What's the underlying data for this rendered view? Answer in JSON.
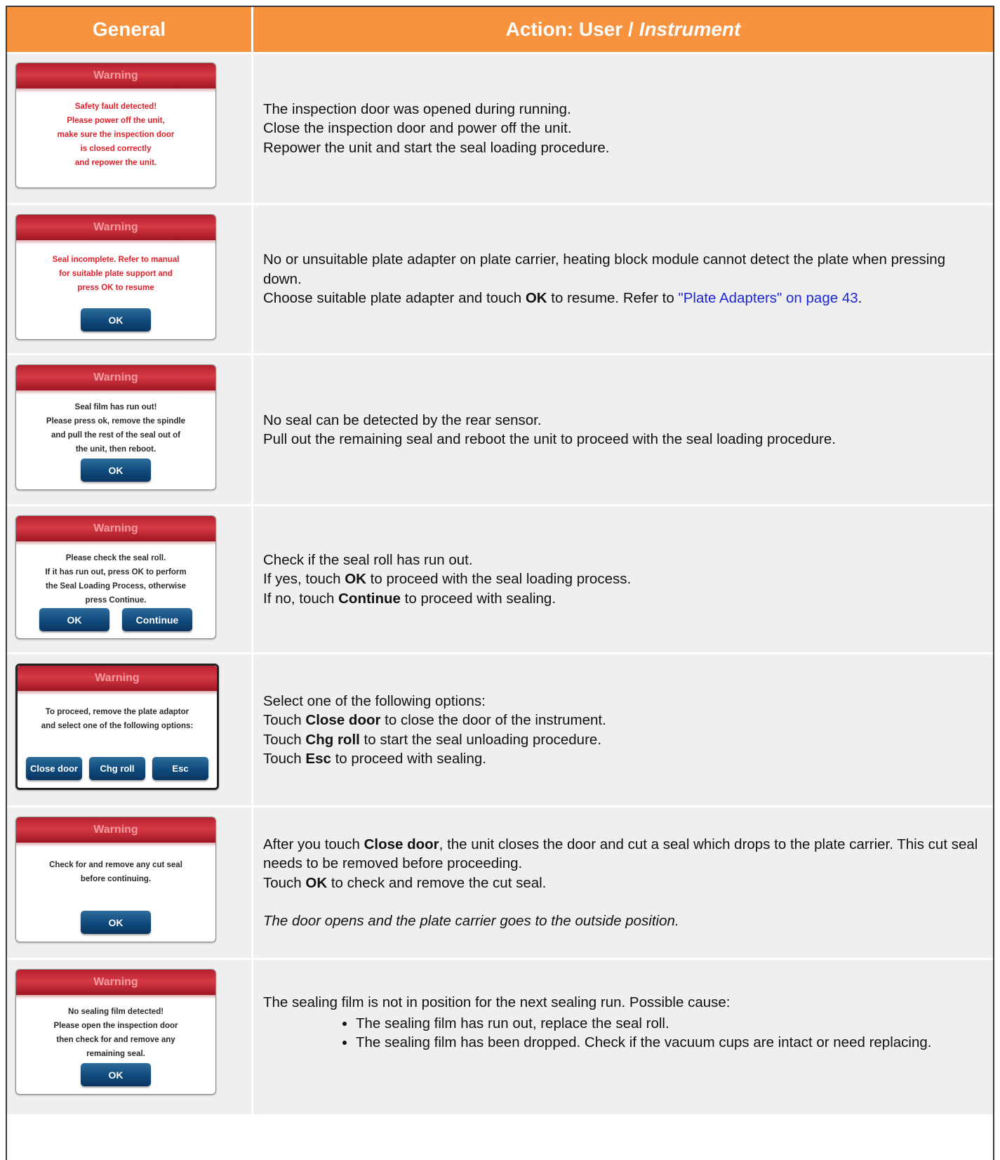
{
  "header": {
    "col1": "General",
    "col2_prefix": "Action: User /",
    "col2_italic": "Instrument"
  },
  "rows": [
    {
      "dialog": {
        "title": "Warning",
        "lines": [
          "Safety fault detected!",
          "Please power off the unit,",
          "make sure the inspection door",
          "is closed correctly",
          "and repower the unit."
        ]
      },
      "action": [
        "The inspection door was opened during running.",
        "Close the inspection door and power off the unit.",
        "Repower the unit and start the seal loading procedure."
      ]
    },
    {
      "dialog": {
        "title": "Warning",
        "lines": [
          "Seal incomplete. Refer to manual",
          "for suitable plate support and",
          "press OK to resume"
        ],
        "ok": "OK"
      },
      "action": {
        "line1": "No or unsuitable plate adapter on plate carrier, heating block module cannot detect the plate when pressing down.",
        "pre": "Choose suitable plate adapter and touch ",
        "bold": "OK",
        "mid": " to resume. Refer to ",
        "link": "\"Plate Adapters\" on page 43",
        "post": "."
      }
    },
    {
      "dialog": {
        "title": "Warning",
        "lines": [
          "Seal film has run out!",
          "Please press ok, remove the spindle",
          "and pull the rest of the seal out of",
          "the unit, then reboot."
        ],
        "ok": "OK"
      },
      "action": [
        "No seal can be detected by the rear sensor.",
        "Pull out the remaining seal and reboot the unit to proceed with the seal loading procedure."
      ]
    },
    {
      "dialog": {
        "title": "Warning",
        "lines": [
          "Please check the seal roll.",
          "If it has run out, press OK to perform",
          "the Seal Loading Process, otherwise",
          "press Continue."
        ],
        "ok": "OK",
        "continue": "Continue"
      },
      "action": {
        "line1": "Check if the seal roll has run out.",
        "l2_pre": "If yes, touch ",
        "l2_bold": "OK",
        "l2_post": " to proceed with the seal loading process.",
        "l3_pre": "If no, touch ",
        "l3_bold": "Continue",
        "l3_post": " to proceed with sealing."
      }
    },
    {
      "dialog": {
        "title": "Warning",
        "lines": [
          "To proceed, remove the plate adaptor",
          "and select one of the following options:"
        ],
        "close_door": "Close door",
        "chg_roll": "Chg roll",
        "esc": "Esc"
      },
      "action": {
        "line1": "Select one of the following options:",
        "pre": "Touch ",
        "b1": "Close door",
        "p1": " to close the door of the instrument.",
        "b2": "Chg roll",
        "p2": " to start the seal unloading procedure.",
        "b3": "Esc",
        "p3": " to proceed with sealing."
      }
    },
    {
      "dialog": {
        "title": "Warning",
        "lines": [
          "Check for and remove any cut seal",
          "before continuing."
        ],
        "ok": "OK"
      },
      "action": {
        "l1_pre": "After you touch ",
        "l1_bold": "Close door",
        "l1_post": ", the unit closes the door and cut a seal which drops to the plate carrier. This cut seal needs to be removed before proceeding.",
        "l2_pre": "Touch ",
        "l2_bold": "OK",
        "l2_post": " to check and remove the cut seal.",
        "italic": "The door opens and the plate carrier goes to the outside position."
      }
    },
    {
      "dialog": {
        "title": "Warning",
        "lines": [
          "No sealing film detected!",
          "Please open the inspection door",
          "then check for and remove any",
          "remaining seal."
        ],
        "ok": "OK"
      },
      "action": {
        "line1": "The sealing film is not in position for the next sealing run. Possible cause:",
        "bullets": [
          "The sealing film has run out, replace the seal roll.",
          "The sealing film has been dropped. Check if the vacuum cups are intact or need replacing."
        ]
      }
    }
  ]
}
